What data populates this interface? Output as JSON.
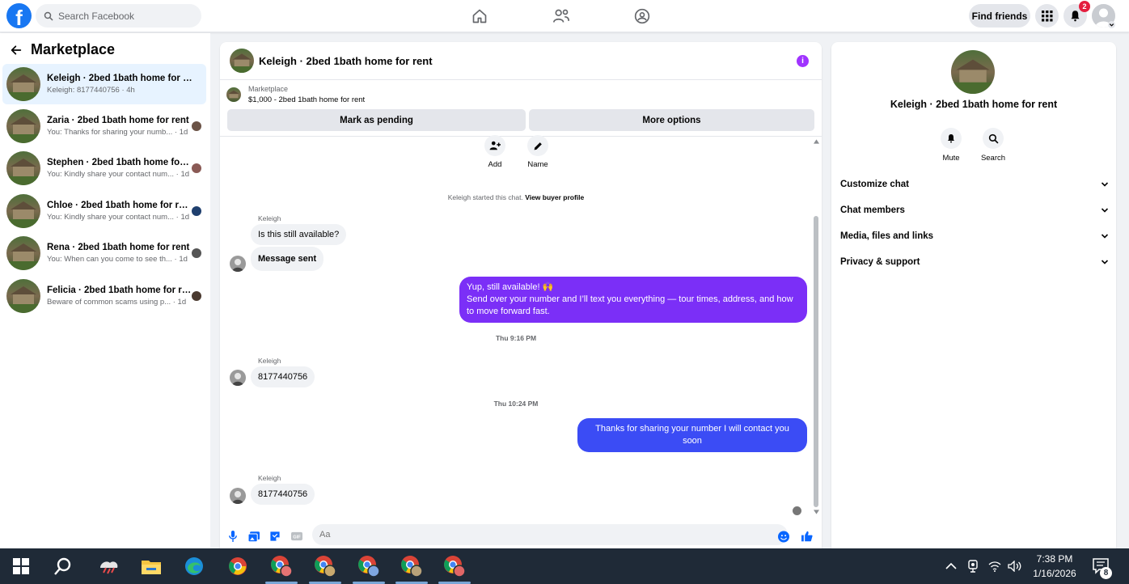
{
  "header": {
    "search_placeholder": "Search Facebook",
    "find_friends_label": "Find friends",
    "notification_count": "2"
  },
  "sidebar": {
    "title": "Marketplace",
    "conversations": [
      {
        "name": "Keleigh · 2bed 1bath home for rent",
        "preview": "Keleigh: 8177440756 · 4h",
        "active": true
      },
      {
        "name": "Zaria · 2bed 1bath home for rent",
        "preview": "You: Thanks for sharing your numb... · 1d"
      },
      {
        "name": "Stephen · 2bed 1bath home for r...",
        "preview": "You: Kindly share your contact num... · 1d"
      },
      {
        "name": "Chloe · 2bed 1bath home for rent",
        "preview": "You: Kindly share your contact num... · 1d"
      },
      {
        "name": "Rena · 2bed 1bath home for rent",
        "preview": "You: When can you come to see th... · 1d"
      },
      {
        "name": "Felicia · 2bed 1bath home for rent",
        "preview": "Beware of common scams using p... · 1d"
      }
    ]
  },
  "chat": {
    "title": "Keleigh · 2bed 1bath home for rent",
    "listing_source": "Marketplace",
    "listing_summary": "$1,000 - 2bed 1bath home for rent",
    "mark_pending_label": "Mark as pending",
    "more_options_label": "More options",
    "add_label": "Add",
    "name_label": "Name",
    "system_message": "Keleigh started this chat.",
    "view_buyer_profile": "View buyer profile",
    "messages": [
      {
        "sender": "Keleigh",
        "text": "Is this still available?"
      },
      {
        "text": "Message sent"
      },
      {
        "text_line1": "Yup, still available! 🙌",
        "text_line2": "Send over your number and I’ll text you everything — tour times, address, and how to move forward fast."
      },
      {
        "timestamp": "Thu 9:16 PM"
      },
      {
        "sender": "Keleigh",
        "text": "8177440756"
      },
      {
        "timestamp": "Thu 10:24 PM"
      },
      {
        "text": "Thanks for sharing your number I will contact you soon"
      },
      {
        "sender": "Keleigh",
        "text": "8177440756"
      }
    ],
    "composer_placeholder": "Aa"
  },
  "info_panel": {
    "title": "Keleigh · 2bed 1bath home for rent",
    "mute_label": "Mute",
    "search_label": "Search",
    "sections": [
      "Customize chat",
      "Chat members",
      "Media, files and links",
      "Privacy & support"
    ]
  },
  "taskbar": {
    "time": "7:38 PM",
    "date": "1/16/2026",
    "notification_count": "8"
  },
  "colors": {
    "brand_blue": "#1877f2",
    "outgoing_purple": "#7b2ff7",
    "outgoing_blue": "#3b4cf5",
    "info_purple": "#a033ff",
    "taskbar": "#1f2a37"
  }
}
